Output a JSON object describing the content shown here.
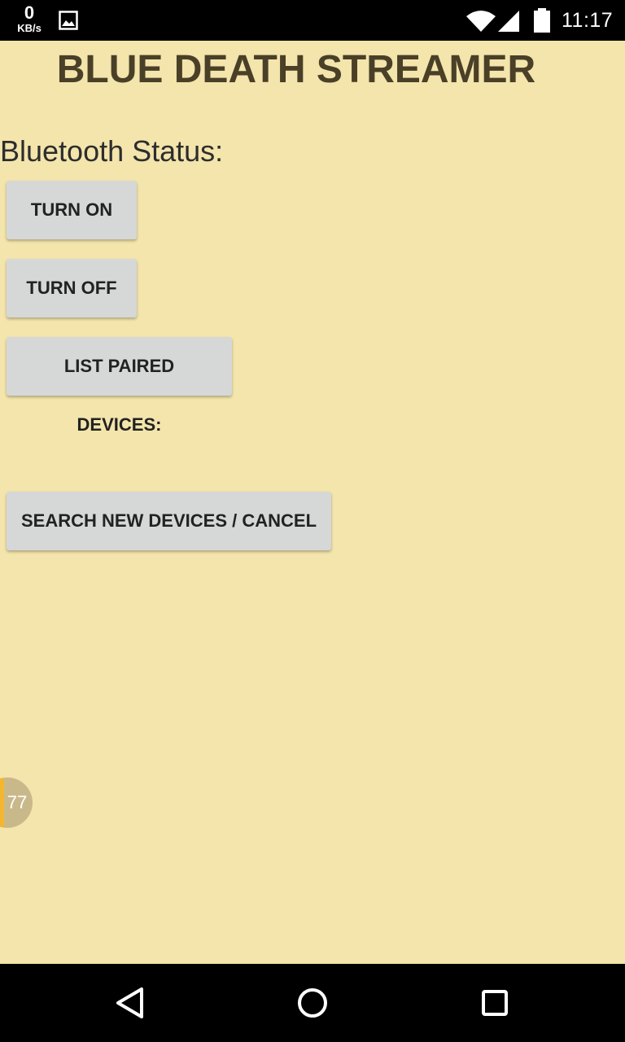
{
  "status_bar": {
    "net_speed_value": "0",
    "net_speed_unit": "KB/s",
    "time": "11:17",
    "icons": [
      "image-icon",
      "wifi-icon",
      "signal-icon",
      "battery-icon"
    ]
  },
  "app": {
    "title": "BLUE DEATH STREAMER",
    "bluetooth_status_label": "Bluetooth Status:",
    "buttons": {
      "turn_on": "TURN ON",
      "turn_off": "TURN OFF",
      "list_paired": "LIST PAIRED DEVICES:",
      "search": "SEARCH NEW DEVICES / CANCEL"
    }
  },
  "floating_bubble": {
    "count": "77",
    "accent_color": "#f2b630"
  },
  "nav_bar": {
    "icons": [
      "back-icon",
      "home-icon",
      "recents-icon"
    ]
  },
  "colors": {
    "background": "#f3e5ab",
    "title": "#4a3f27",
    "button": "#d6d7d7"
  }
}
